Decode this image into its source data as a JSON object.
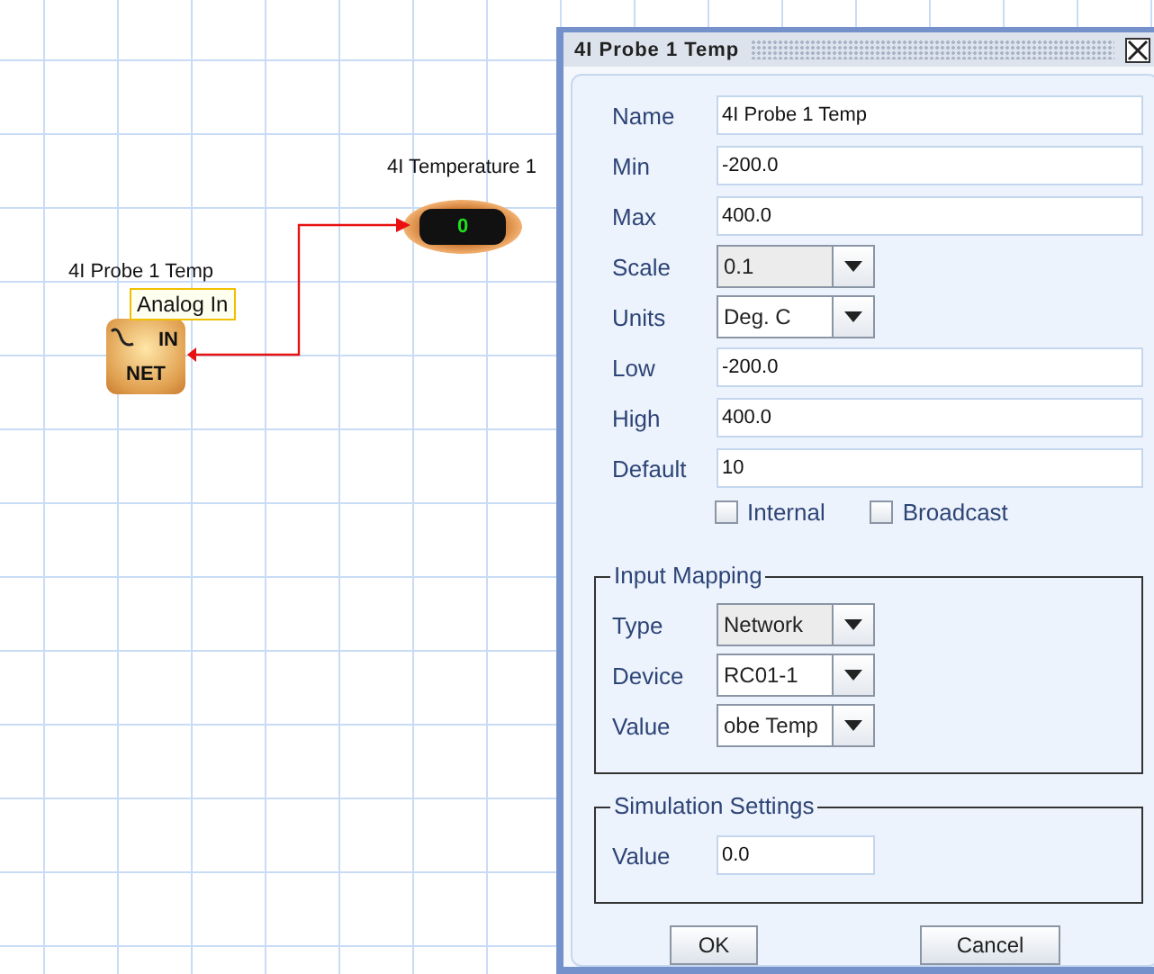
{
  "canvas": {
    "nodes": [
      {
        "kind": "input",
        "label": "4I Probe 1 Temp",
        "tooltip": "Analog In",
        "top_text": "IN",
        "bottom_text": "NET"
      },
      {
        "kind": "display",
        "label": "4I Temperature 1",
        "reading": "0"
      }
    ]
  },
  "dialog": {
    "title": "4I Probe 1 Temp",
    "fields": [
      {
        "kind": "text",
        "label": "Name",
        "value": "4I Probe 1 Temp"
      },
      {
        "kind": "text",
        "label": "Min",
        "value": "-200.0"
      },
      {
        "kind": "text",
        "label": "Max",
        "value": "400.0"
      },
      {
        "kind": "dropdown",
        "label": "Scale",
        "value": "0.1",
        "disabled": true
      },
      {
        "kind": "dropdown",
        "label": "Units",
        "value": "Deg. C",
        "disabled": false
      },
      {
        "kind": "text",
        "label": "Low",
        "value": "-200.0"
      },
      {
        "kind": "text",
        "label": "High",
        "value": "400.0"
      },
      {
        "kind": "text",
        "label": "Default",
        "value": "10"
      }
    ],
    "checkboxes": [
      {
        "label": "Internal",
        "checked": false
      },
      {
        "label": "Broadcast",
        "checked": false
      }
    ],
    "groups": [
      {
        "title": "Input Mapping",
        "fields": [
          {
            "kind": "dropdown",
            "label": "Type",
            "value": "Network",
            "disabled": true
          },
          {
            "kind": "dropdown",
            "label": "Device",
            "value": "RC01-1",
            "disabled": false
          },
          {
            "kind": "dropdown",
            "label": "Value",
            "value": "obe Temp",
            "disabled": false
          }
        ]
      },
      {
        "title": "Simulation Settings",
        "fields": [
          {
            "kind": "short",
            "label": "Value",
            "value": "0.0"
          }
        ]
      }
    ],
    "buttons": [
      "OK",
      "Cancel"
    ]
  }
}
